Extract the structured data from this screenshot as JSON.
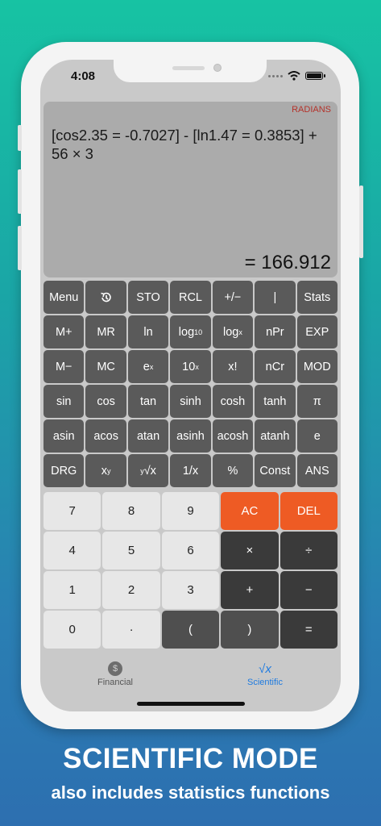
{
  "status": {
    "time": "4:08"
  },
  "display": {
    "mode": "RADIANS",
    "expression": "[cos2.35 = -0.7027] - [ln1.47 = 0.3853] + 56 × 3",
    "result": "= 166.912"
  },
  "sci_keys": [
    [
      "Menu",
      "history-icon",
      "STO",
      "RCL",
      "+/−",
      "|",
      "Stats"
    ],
    [
      "M+",
      "MR",
      "ln",
      "log10",
      "logx",
      "nPr",
      "EXP"
    ],
    [
      "M−",
      "MC",
      "ex",
      "10x",
      "x!",
      "nCr",
      "MOD"
    ],
    [
      "sin",
      "cos",
      "tan",
      "sinh",
      "cosh",
      "tanh",
      "π"
    ],
    [
      "asin",
      "acos",
      "atan",
      "asinh",
      "acosh",
      "atanh",
      "e"
    ],
    [
      "DRG",
      "xy",
      "y√x",
      "1/x",
      "%",
      "Const",
      "ANS"
    ]
  ],
  "labels": {
    "menu": "Menu",
    "sto": "STO",
    "rcl": "RCL",
    "sign": "+/−",
    "bar": "|",
    "stats": "Stats",
    "mplus": "M+",
    "mr": "MR",
    "ln": "ln",
    "log": "log",
    "log_sub": "10",
    "logx_sub": "x",
    "npr": "nPr",
    "exp": "EXP",
    "mminus": "M−",
    "mc": "MC",
    "e": "e",
    "sup_x": "x",
    "ten": "10",
    "fact": "x!",
    "ncr": "nCr",
    "mod": "MOD",
    "sin": "sin",
    "cos": "cos",
    "tan": "tan",
    "sinh": "sinh",
    "cosh": "cosh",
    "tanh": "tanh",
    "pi": "π",
    "asin": "asin",
    "acos": "acos",
    "atan": "atan",
    "asinh": "asinh",
    "acosh": "acosh",
    "atanh": "atanh",
    "econst": "e",
    "drg": "DRG",
    "x": "x",
    "sup_y": "y",
    "root": "√x",
    "inv": "1/x",
    "pct": "%",
    "const": "Const",
    "ans": "ANS"
  },
  "num_keys": {
    "seven": "7",
    "eight": "8",
    "nine": "9",
    "ac": "AC",
    "del": "DEL",
    "four": "4",
    "five": "5",
    "six": "6",
    "mul": "×",
    "div": "÷",
    "one": "1",
    "two": "2",
    "three": "3",
    "add": "+",
    "sub": "−",
    "zero": "0",
    "dot": "·",
    "lparen": "(",
    "rparen": ")",
    "eq": "="
  },
  "tabs": {
    "financial": "Financial",
    "financial_icon": "$",
    "scientific": "Scientific",
    "scientific_icon": "√x"
  },
  "marketing": {
    "title": "SCIENTIFIC MODE",
    "subtitle": "also includes statistics functions"
  },
  "colors": {
    "accent_orange": "#ee5b24",
    "tab_active": "#1f7be0",
    "mode_red": "#b4322a"
  }
}
